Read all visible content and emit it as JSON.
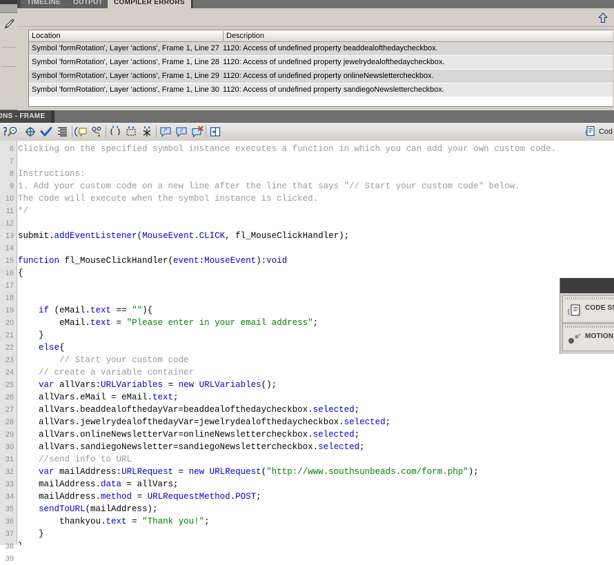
{
  "tools_panel": {
    "pen_tool": "pen-tool"
  },
  "compiler_panel": {
    "tabs": [
      {
        "label": "TIMELINE",
        "active": false
      },
      {
        "label": "OUTPUT",
        "active": false
      },
      {
        "label": "COMPILER ERRORS",
        "active": true
      }
    ],
    "scroll_up_icon": "scroll-up-arrow",
    "columns": [
      "Location",
      "Description"
    ],
    "rows": [
      {
        "location": "Symbol 'formRotation', Layer 'actions', Frame 1, Line 27",
        "description": "1120: Access of undefined property beaddealofthedaycheckbox."
      },
      {
        "location": "Symbol 'formRotation', Layer 'actions', Frame 1, Line 28",
        "description": "1120: Access of undefined property jewelrydealofthedaycheckbox."
      },
      {
        "location": "Symbol 'formRotation', Layer 'actions', Frame 1, Line 29",
        "description": "1120: Access of undefined property onlineNewslettercheckbox."
      },
      {
        "location": "Symbol 'formRotation', Layer 'actions', Frame 1, Line 30",
        "description": "1120: Access of undefined property sandiegoNewslettercheckbox."
      }
    ]
  },
  "actions_panel": {
    "tab_label": "ONS - FRAME",
    "toolbar_icons": [
      "pin-script-icon",
      "find-icon",
      "find-target-icon",
      "check-syntax-icon",
      "auto-format-icon",
      "show-code-hint-icon",
      "debug-options-icon",
      "collapse-between-braces-icon",
      "collapse-selection-icon",
      "expand-all-icon",
      "apply-block-comment-icon",
      "apply-line-comment-icon",
      "remove-comment-icon",
      "show-hide-toolbox-icon"
    ],
    "code_assist_label": "Cod",
    "code_assist_icon": "code-assist-icon"
  },
  "code_editor": {
    "first_line_number": 6,
    "lines": [
      {
        "n": 6,
        "tokens": [
          {
            "t": "Clicking on the specified symbol instance executes a function in which you can add your own custom code.",
            "c": "c-com"
          }
        ]
      },
      {
        "n": 7,
        "tokens": []
      },
      {
        "n": 8,
        "tokens": [
          {
            "t": "Instructions:",
            "c": "c-com"
          }
        ]
      },
      {
        "n": 9,
        "tokens": [
          {
            "t": "1. Add your custom code on a new line after the line that says \"// Start your custom code\" below.",
            "c": "c-com"
          }
        ]
      },
      {
        "n": 10,
        "tokens": [
          {
            "t": "The code will execute when the symbol instance is clicked.",
            "c": "c-com"
          }
        ]
      },
      {
        "n": 11,
        "tokens": [
          {
            "t": "*/",
            "c": "c-com"
          }
        ]
      },
      {
        "n": 12,
        "tokens": []
      },
      {
        "n": 13,
        "tokens": [
          {
            "t": "submit.",
            "c": "c-pln"
          },
          {
            "t": "addEventListener",
            "c": "c-key"
          },
          {
            "t": "(",
            "c": "c-pln"
          },
          {
            "t": "MouseEvent.CLICK",
            "c": "c-key"
          },
          {
            "t": ", fl_MouseClickHandler);",
            "c": "c-pln"
          }
        ]
      },
      {
        "n": 14,
        "tokens": []
      },
      {
        "n": 15,
        "tokens": [
          {
            "t": "function",
            "c": "c-key"
          },
          {
            "t": " fl_MouseClickHandler(",
            "c": "c-pln"
          },
          {
            "t": "event",
            "c": "c-key"
          },
          {
            "t": ":",
            "c": "c-pln"
          },
          {
            "t": "MouseEvent",
            "c": "c-key"
          },
          {
            "t": "):",
            "c": "c-pln"
          },
          {
            "t": "void",
            "c": "c-key"
          }
        ]
      },
      {
        "n": 16,
        "tokens": [
          {
            "t": "{",
            "c": "c-pln"
          }
        ]
      },
      {
        "n": 17,
        "tokens": []
      },
      {
        "n": 18,
        "tokens": []
      },
      {
        "n": 19,
        "tokens": [
          {
            "t": "    ",
            "c": "c-pln"
          },
          {
            "t": "if",
            "c": "c-key"
          },
          {
            "t": " (eMail.",
            "c": "c-pln"
          },
          {
            "t": "text",
            "c": "c-prp"
          },
          {
            "t": " == ",
            "c": "c-pln"
          },
          {
            "t": "\"\"",
            "c": "c-str"
          },
          {
            "t": "){",
            "c": "c-pln"
          }
        ]
      },
      {
        "n": 20,
        "tokens": [
          {
            "t": "        eMail.",
            "c": "c-pln"
          },
          {
            "t": "text",
            "c": "c-prp"
          },
          {
            "t": " = ",
            "c": "c-pln"
          },
          {
            "t": "\"Please enter in your email address\"",
            "c": "c-str"
          },
          {
            "t": ";",
            "c": "c-pln"
          }
        ]
      },
      {
        "n": 21,
        "tokens": [
          {
            "t": "    }",
            "c": "c-pln"
          }
        ]
      },
      {
        "n": 22,
        "tokens": [
          {
            "t": "    ",
            "c": "c-pln"
          },
          {
            "t": "else",
            "c": "c-key"
          },
          {
            "t": "{",
            "c": "c-pln"
          }
        ]
      },
      {
        "n": 23,
        "tokens": [
          {
            "t": "        // Start your custom code",
            "c": "c-com"
          }
        ]
      },
      {
        "n": 24,
        "tokens": [
          {
            "t": "    // create a variable container",
            "c": "c-com"
          }
        ]
      },
      {
        "n": 25,
        "tokens": [
          {
            "t": "    ",
            "c": "c-pln"
          },
          {
            "t": "var",
            "c": "c-key"
          },
          {
            "t": " allVars:",
            "c": "c-pln"
          },
          {
            "t": "URLVariables",
            "c": "c-key"
          },
          {
            "t": " = ",
            "c": "c-pln"
          },
          {
            "t": "new",
            "c": "c-key"
          },
          {
            "t": " ",
            "c": "c-pln"
          },
          {
            "t": "URLVariables",
            "c": "c-key"
          },
          {
            "t": "();",
            "c": "c-pln"
          }
        ]
      },
      {
        "n": 26,
        "tokens": [
          {
            "t": "    allVars.eMail = eMail.",
            "c": "c-pln"
          },
          {
            "t": "text",
            "c": "c-prp"
          },
          {
            "t": ";",
            "c": "c-pln"
          }
        ]
      },
      {
        "n": 27,
        "tokens": [
          {
            "t": "    allVars.beaddealofthedayVar=beaddealofthedaycheckbox.",
            "c": "c-pln"
          },
          {
            "t": "selected",
            "c": "c-prp"
          },
          {
            "t": ";",
            "c": "c-pln"
          }
        ]
      },
      {
        "n": 28,
        "tokens": [
          {
            "t": "    allVars.jewelrydealofthedayVar=jewelrydealofthedaycheckbox.",
            "c": "c-pln"
          },
          {
            "t": "selected",
            "c": "c-prp"
          },
          {
            "t": ";",
            "c": "c-pln"
          }
        ]
      },
      {
        "n": 29,
        "tokens": [
          {
            "t": "    allVars.onlineNewsletterVar=onlineNewslettercheckbox.",
            "c": "c-pln"
          },
          {
            "t": "selected",
            "c": "c-prp"
          },
          {
            "t": ";",
            "c": "c-pln"
          }
        ]
      },
      {
        "n": 30,
        "tokens": [
          {
            "t": "    allVars.sandiegoNewsletter=sandiegoNewslettercheckbox.",
            "c": "c-pln"
          },
          {
            "t": "selected",
            "c": "c-prp"
          },
          {
            "t": ";",
            "c": "c-pln"
          }
        ]
      },
      {
        "n": 31,
        "tokens": [
          {
            "t": "    //send info to URL",
            "c": "c-com"
          }
        ]
      },
      {
        "n": 32,
        "tokens": [
          {
            "t": "    ",
            "c": "c-pln"
          },
          {
            "t": "var",
            "c": "c-key"
          },
          {
            "t": " mailAddress:",
            "c": "c-pln"
          },
          {
            "t": "URLRequest",
            "c": "c-key"
          },
          {
            "t": " = ",
            "c": "c-pln"
          },
          {
            "t": "new",
            "c": "c-key"
          },
          {
            "t": " ",
            "c": "c-pln"
          },
          {
            "t": "URLRequest",
            "c": "c-key"
          },
          {
            "t": "(",
            "c": "c-pln"
          },
          {
            "t": "\"http://www.southsunbeads.com/form.php\"",
            "c": "c-str"
          },
          {
            "t": ");",
            "c": "c-pln"
          }
        ]
      },
      {
        "n": 33,
        "tokens": [
          {
            "t": "    mailAddress.",
            "c": "c-pln"
          },
          {
            "t": "data",
            "c": "c-prp"
          },
          {
            "t": " = allVars;",
            "c": "c-pln"
          }
        ]
      },
      {
        "n": 34,
        "tokens": [
          {
            "t": "    mailAddress.",
            "c": "c-pln"
          },
          {
            "t": "method",
            "c": "c-prp"
          },
          {
            "t": " = ",
            "c": "c-pln"
          },
          {
            "t": "URLRequestMethod.POST",
            "c": "c-key"
          },
          {
            "t": ";",
            "c": "c-pln"
          }
        ]
      },
      {
        "n": 35,
        "tokens": [
          {
            "t": "    ",
            "c": "c-pln"
          },
          {
            "t": "sendToURL",
            "c": "c-key"
          },
          {
            "t": "(mailAddress);",
            "c": "c-pln"
          }
        ]
      },
      {
        "n": 36,
        "tokens": [
          {
            "t": "        thankyou.",
            "c": "c-pln"
          },
          {
            "t": "text",
            "c": "c-prp"
          },
          {
            "t": " = ",
            "c": "c-pln"
          },
          {
            "t": "\"Thank you!\"",
            "c": "c-str"
          },
          {
            "t": ";",
            "c": "c-pln"
          }
        ]
      },
      {
        "n": 37,
        "tokens": [
          {
            "t": "    }",
            "c": "c-pln"
          }
        ]
      },
      {
        "n": 38,
        "tokens": [
          {
            "t": "}",
            "c": "c-pln"
          }
        ]
      },
      {
        "n": 39,
        "tokens": []
      }
    ]
  },
  "right_panels": [
    {
      "label": "CODE SN",
      "icon": "code-snippets-icon"
    },
    {
      "label": "MOTION",
      "icon": "motion-presets-icon"
    }
  ],
  "colors": {
    "panel_bg": "#d4d0c8",
    "code_bg": "#ffffff",
    "keyword": "#0000cc",
    "string": "#007f00",
    "comment": "#9a9a9a",
    "row_odd": "#d7d7d7",
    "row_even": "#e8e8e8"
  }
}
